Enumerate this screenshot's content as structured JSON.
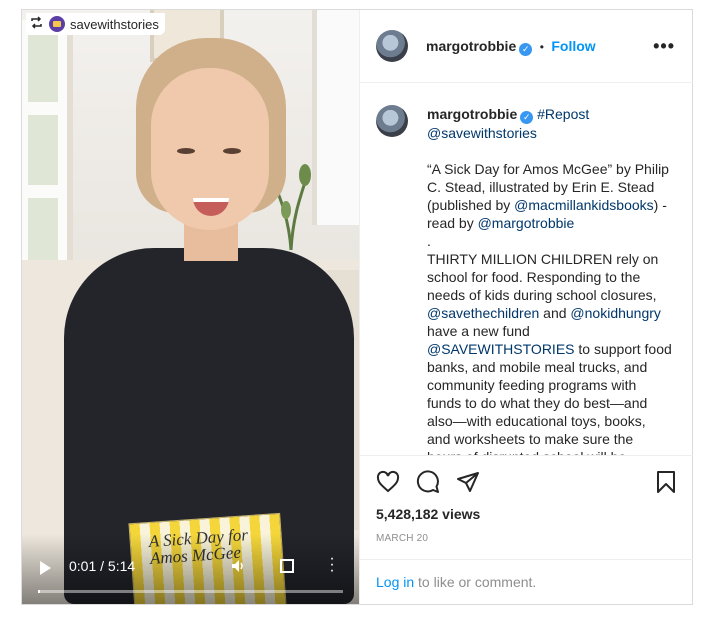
{
  "video": {
    "repost_source": "savewithstories",
    "book_title": "A Sick Day for Amos McGee",
    "time": "0:01 / 5:14",
    "progress": 0.003
  },
  "header": {
    "username": "margotrobbie",
    "separator": "•",
    "follow": "Follow",
    "more": "•••"
  },
  "caption": {
    "username": "margotrobbie",
    "tag": "#Repost",
    "mention1": "@savewithstories",
    "line_a": "“A Sick Day for Amos McGee” by Philip C. Stead, illustrated by Erin E. Stead (published by",
    "mention2": "@macmillankidsbooks",
    "line_b": ") - read by",
    "mention3": "@margotrobbie",
    "dot": ".",
    "line_c": "THIRTY MILLION CHILDREN rely on school for food. Responding to the needs of kids during school closures,",
    "mention4": "@savethechildren",
    "and": "and",
    "mention5": "@nokidhungry",
    "line_d": "have a new fund",
    "mention6": "@SAVEWITHSTORIES",
    "line_e": "to support food banks, and mobile meal trucks, and community feeding programs with funds to do what they do best—and also—with educational toys, books, and worksheets to make sure the hours of disrupted school will be"
  },
  "actions": {
    "views": "5,428,182 views",
    "date": "MARCH 20"
  },
  "login": {
    "link": "Log in",
    "rest": " to like or comment."
  }
}
